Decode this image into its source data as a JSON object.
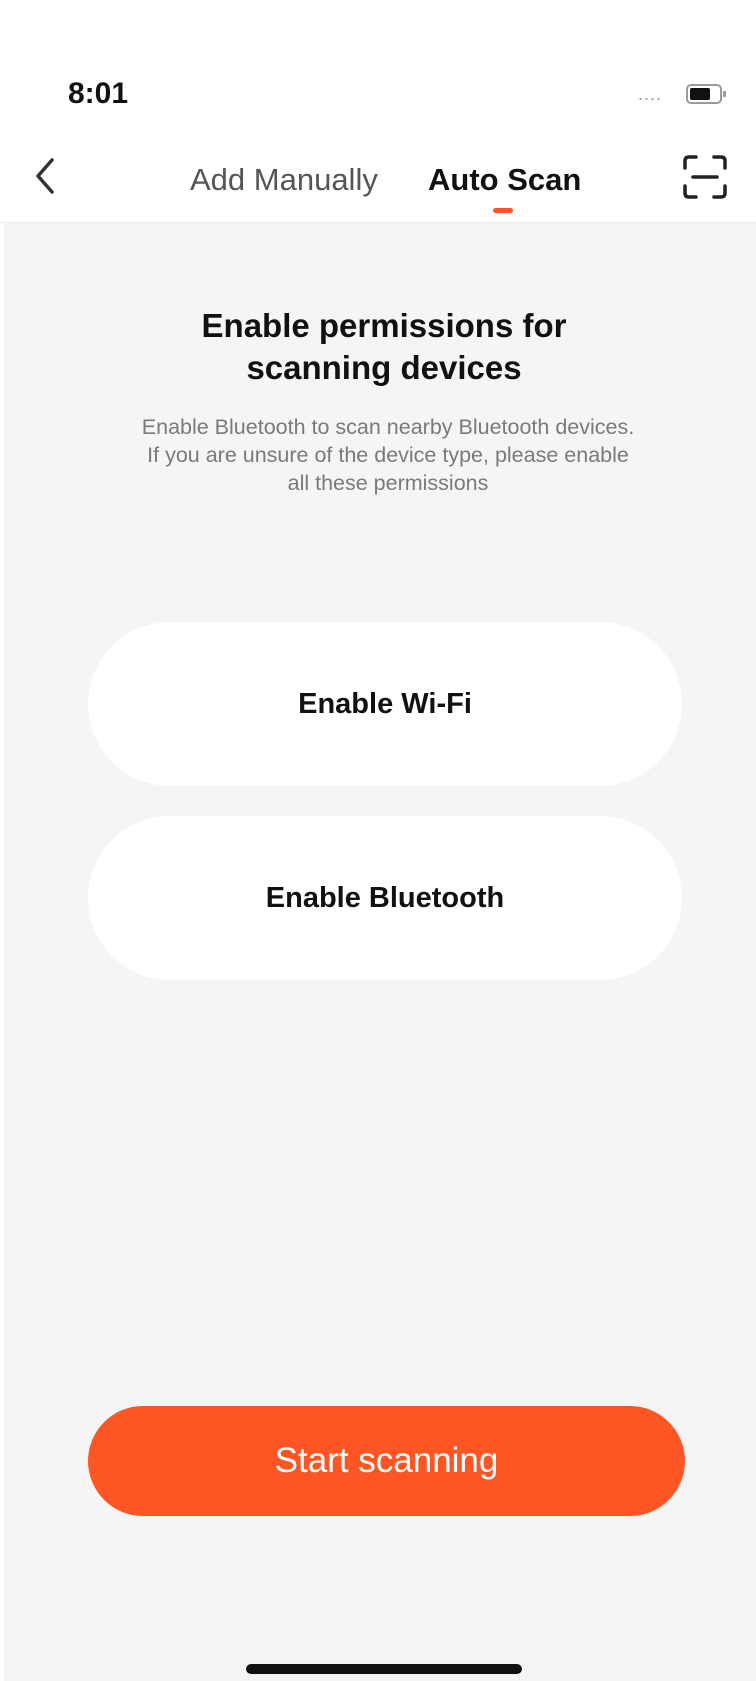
{
  "status_bar": {
    "time": "8:01",
    "signal": "....",
    "battery_icon": "battery-icon"
  },
  "nav": {
    "back_icon": "chevron-left-icon",
    "tabs": [
      {
        "label": "Add Manually",
        "active": false
      },
      {
        "label": "Auto Scan",
        "active": true
      }
    ],
    "scan_icon": "scan-qr-icon",
    "accent_color": "#fd5624"
  },
  "main": {
    "title_line1": "Enable permissions for",
    "title_line2": "scanning devices",
    "description": [
      "Enable Bluetooth to scan nearby Bluetooth devices.",
      "If you are unsure of the device type, please enable",
      "all these permissions"
    ],
    "buttons": {
      "wifi": "Enable Wi-Fi",
      "bluetooth": "Enable Bluetooth",
      "start": "Start scanning"
    }
  },
  "colors": {
    "background": "#f5f5f5",
    "card": "#ffffff",
    "primary": "#fd5624"
  }
}
